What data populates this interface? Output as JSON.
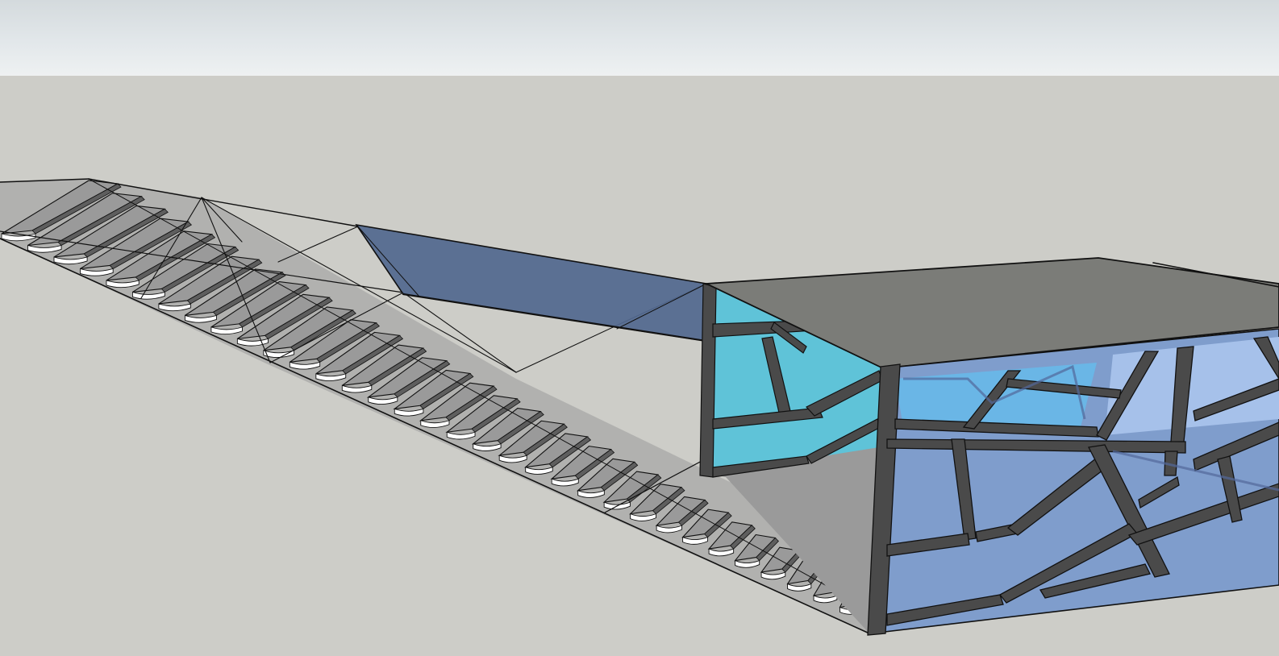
{
  "scene": {
    "background": {
      "sky_top": "#d4dadd",
      "sky_bottom": "#eef1f2",
      "ground": "#cdcdc8"
    },
    "colors": {
      "tread_top": "#9a9a9a",
      "tread_side": "#5e5e5e",
      "tread_nosing": "#ffffff",
      "stringer": "#9b9b9b",
      "bridge_glass": "#52688f",
      "roof": "#7b7c78",
      "frame": "#4a4a4a",
      "glass_cyan": "#5fc3d8",
      "glass_blue": "#7f9dcc",
      "glass_light": "#a6c1ea",
      "edges": "#111111"
    },
    "objects": [
      "staircase",
      "glass-bridge",
      "pavilion-box"
    ]
  }
}
